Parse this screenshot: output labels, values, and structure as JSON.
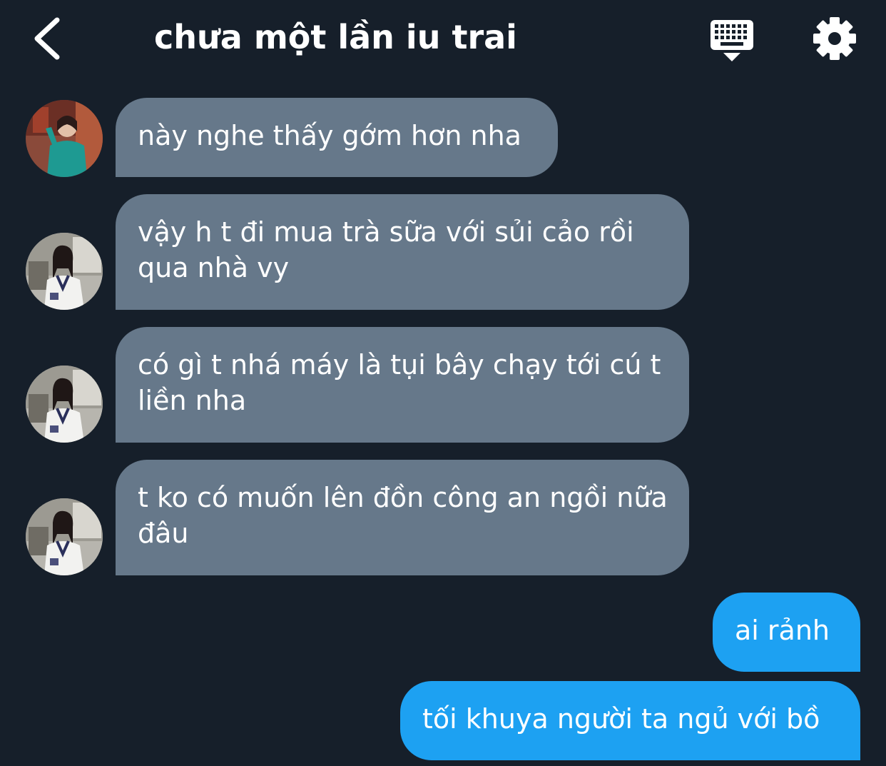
{
  "header": {
    "title": "chưa một lần iu trai",
    "back_icon": "chevron-left-icon",
    "keyboard_icon": "keyboard-icon",
    "settings_icon": "gear-icon"
  },
  "colors": {
    "background": "#161f2a",
    "incoming_bubble": "#66788a",
    "outgoing_bubble": "#1da1f2",
    "text": "#ffffff"
  },
  "messages": [
    {
      "direction": "incoming",
      "avatar": "avatar-green-dress",
      "text": "này nghe thấy gớm hơn nha"
    },
    {
      "direction": "incoming",
      "avatar": "avatar-white-vest",
      "text": "vậy h t đi mua trà sữa với sủi cảo rồi qua nhà vy"
    },
    {
      "direction": "incoming",
      "avatar": "avatar-white-vest",
      "text": "có gì t nhá máy là tụi bây chạy tới cú t liền nha"
    },
    {
      "direction": "incoming",
      "avatar": "avatar-white-vest",
      "text": "t ko có muốn lên đồn công an ngồi nữa đâu"
    },
    {
      "direction": "outgoing",
      "text": "ai rảnh"
    },
    {
      "direction": "outgoing",
      "text": "tối khuya người ta ngủ với bồ"
    }
  ]
}
